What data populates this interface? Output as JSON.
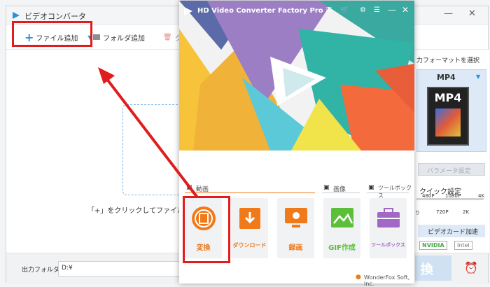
{
  "bg_app": {
    "title": "ビデオコンバータ",
    "toolbar": {
      "add_file": "ファイル追加",
      "add_folder": "フォルダ追加",
      "clear_partial": "ク"
    },
    "hint": "「+」をクリックしてファイルを追加",
    "output_folder_label": "出力フォルダ：",
    "output_folder_value": "D:¥",
    "right_panel": {
      "format_label": "力フォーマットを選択",
      "format_value": "MP4",
      "param_button": "パラメータ設定",
      "quick_setting": "クイック設定",
      "res_row1": [
        "480P",
        "1080P",
        "4K"
      ],
      "res_row2": [
        "り",
        "720P",
        "2K"
      ],
      "hw_accel": "ビデオカード加速",
      "gpu1": "NVIDIA",
      "gpu2": "Intel",
      "run_partial": "換"
    }
  },
  "fg_app": {
    "title": "HD Video Converter Factory Pro",
    "section_video": "動画",
    "section_image": "画像",
    "section_tools": "ツールボックス",
    "tiles": [
      {
        "label": "変換",
        "icon": "film-convert-icon"
      },
      {
        "label": "ダウンロード",
        "icon": "download-icon"
      },
      {
        "label": "録画",
        "icon": "screen-record-icon"
      },
      {
        "label": "GIF作成",
        "icon": "image-gif-icon"
      },
      {
        "label": "ツールボックス",
        "icon": "toolbox-icon"
      }
    ],
    "footer": "WonderFox Soft, Inc."
  },
  "colors": {
    "accent_red": "#e01c1c",
    "accent_orange": "#f07a1a",
    "brand_blue": "#2b8fe0"
  }
}
